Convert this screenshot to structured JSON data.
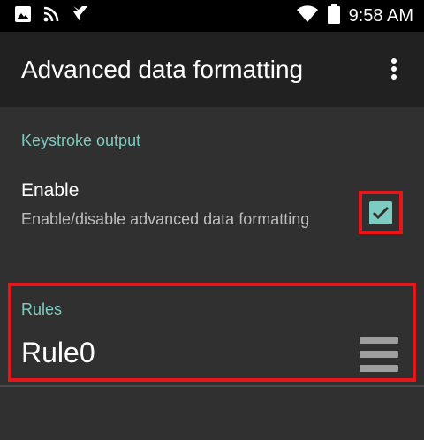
{
  "status_bar": {
    "time": "9:58 AM",
    "icons": [
      "image-icon",
      "rss-icon",
      "app-logo-icon",
      "wifi-icon",
      "battery-icon"
    ]
  },
  "app_bar": {
    "title": "Advanced data formatting",
    "overflow_icon": "more-vert-icon"
  },
  "keystroke_section": {
    "header": "Keystroke output",
    "enable": {
      "title": "Enable",
      "summary": "Enable/disable advanced data formatting",
      "checked": true
    }
  },
  "rules_section": {
    "header": "Rules",
    "rules": [
      {
        "name": "Rule0",
        "handle_icon": "drag-handle-icon"
      }
    ]
  },
  "colors": {
    "accent": "#7ecbc1",
    "background": "#303030",
    "app_bar": "#212121",
    "status_bar": "#000000",
    "highlight": "#e8151b"
  }
}
